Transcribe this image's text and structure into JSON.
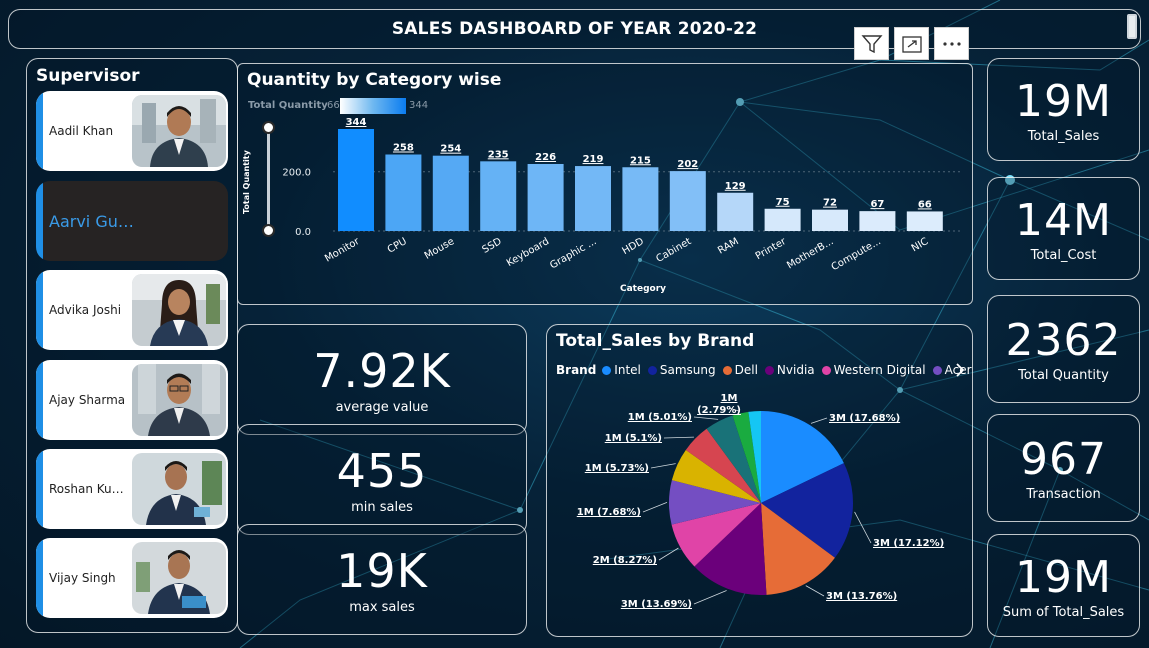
{
  "header": {
    "title": "SALES DASHBOARD OF YEAR 2020-22"
  },
  "toolbar": {
    "icons": [
      "filter-icon",
      "focus-mode-icon",
      "more-options-icon"
    ]
  },
  "supervisor": {
    "title": "Supervisor",
    "items": [
      {
        "name": "Aadil Khan",
        "selected": false
      },
      {
        "name": "Aarvi Gu…",
        "selected": true
      },
      {
        "name": "Advika Joshi",
        "selected": false
      },
      {
        "name": "Ajay Sharma",
        "selected": false
      },
      {
        "name": "Roshan Ku…",
        "selected": false
      },
      {
        "name": "Vijay Singh",
        "selected": false
      }
    ]
  },
  "category_chart": {
    "title": "Quantity by Category wise",
    "legend_label": "Total Quantity",
    "legend_min": "66",
    "legend_max": "344"
  },
  "kpis": {
    "total_sales": {
      "value": "19M",
      "label": "Total_Sales"
    },
    "total_cost": {
      "value": "14M",
      "label": "Total_Cost"
    },
    "total_quantity": {
      "value": "2362",
      "label": "Total Quantity"
    },
    "transaction": {
      "value": "967",
      "label": "Transaction"
    },
    "sum_total_sales": {
      "value": "19M",
      "label": "Sum of Total_Sales"
    },
    "average_value": {
      "value": "7.92K",
      "label": "average value"
    },
    "min_sales": {
      "value": "455",
      "label": "min sales"
    },
    "max_sales": {
      "value": "19K",
      "label": "max sales"
    }
  },
  "brand_chart": {
    "title": "Total_Sales by Brand",
    "legend_key": "Brand",
    "legend": [
      {
        "name": "Intel",
        "color": "#1a8cff"
      },
      {
        "name": "Samsung",
        "color": "#12239e"
      },
      {
        "name": "Dell",
        "color": "#e66c37"
      },
      {
        "name": "Nvidia",
        "color": "#6b007b"
      },
      {
        "name": "Western Digital",
        "color": "#e044a7"
      },
      {
        "name": "Acer",
        "color": "#744ec2"
      }
    ]
  },
  "chart_data": [
    {
      "type": "bar",
      "title": "Quantity by Category wise",
      "xlabel": "Category",
      "ylabel": "Total Quantity",
      "categories": [
        "Monitor",
        "CPU",
        "Mouse",
        "SSD",
        "Keyboard",
        "Graphic ...",
        "HDD",
        "Cabinet",
        "RAM",
        "Printer",
        "MotherB...",
        "Compute...",
        "NIC"
      ],
      "values": [
        344,
        258,
        254,
        235,
        226,
        219,
        215,
        202,
        129,
        75,
        72,
        67,
        66
      ],
      "yticks": [
        "0.0",
        "200.0"
      ],
      "ylim": [
        0,
        344
      ],
      "grid": true,
      "colors": [
        "#118dff",
        "#4ca6f5",
        "#55a9f4",
        "#65b2f5",
        "#6eb6f6",
        "#73b8f6",
        "#77baf6",
        "#82bff7",
        "#b5d7f9",
        "#d5e8fb",
        "#d7e9fb",
        "#dbebfc",
        "#dcecfc"
      ]
    },
    {
      "type": "pie",
      "title": "Total_Sales by Brand",
      "labels": [
        "3M (17.68%)",
        "3M (17.12%)",
        "3M (13.76%)",
        "3M (13.69%)",
        "2M (8.27%)",
        "1M (7.68%)",
        "1M (5.73%)",
        "1M (5.1%)",
        "1M (5.01%)",
        "1M (2.79%)",
        ""
      ],
      "values": [
        17.68,
        17.12,
        13.76,
        13.69,
        8.27,
        7.68,
        5.73,
        5.1,
        5.01,
        2.79,
        2.17
      ],
      "colors": [
        "#1a8cff",
        "#12239e",
        "#e66c37",
        "#6b007b",
        "#e044a7",
        "#744ec2",
        "#d9b300",
        "#d64550",
        "#197278",
        "#1aab40",
        "#15c6f4"
      ]
    }
  ]
}
